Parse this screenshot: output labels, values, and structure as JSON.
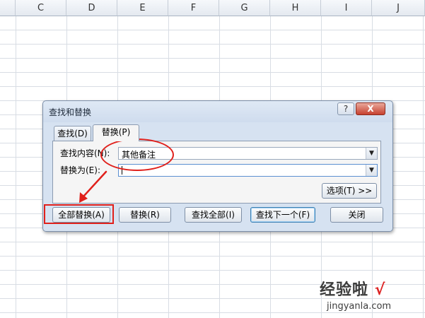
{
  "sheet": {
    "columns": [
      "C",
      "D",
      "E",
      "F",
      "G",
      "H",
      "I",
      "J"
    ]
  },
  "dialog": {
    "title": "查找和替换",
    "help_label": "?",
    "close_label": "X",
    "tabs": [
      {
        "label": "查找(D)"
      },
      {
        "label": "替换(P)"
      }
    ],
    "find_label": "查找内容(N):",
    "find_value": "其他备注",
    "replace_label": "替换为(E):",
    "replace_value": "",
    "options_label": "选项(T) >>",
    "buttons": {
      "replace_all": "全部替换(A)",
      "replace": "替换(R)",
      "find_all": "查找全部(I)",
      "find_next": "查找下一个(F)",
      "close": "关闭"
    }
  },
  "watermark": {
    "logo_text": "经验啦",
    "check": "√",
    "url": "jingyanla.com"
  },
  "colors": {
    "annotation": "#e0201b",
    "dialog_bg": "#d6e2f1"
  }
}
